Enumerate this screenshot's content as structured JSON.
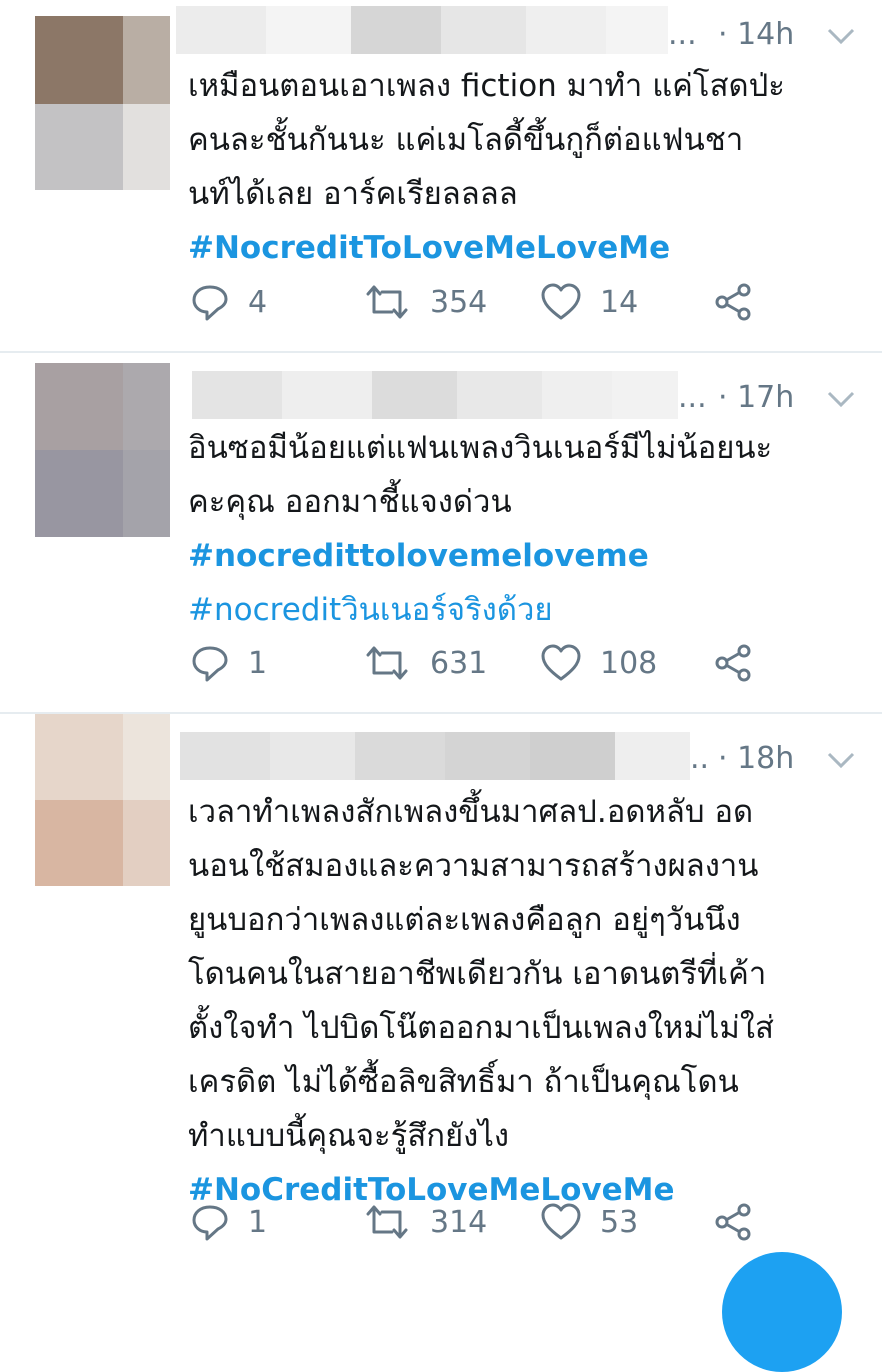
{
  "colors": {
    "link": "#1b95e0",
    "secondary": "#657786",
    "divider": "#e6ecf0",
    "fab": "#1da1f2"
  },
  "tweets": [
    {
      "handle_truncation": "...",
      "time": "· 14h",
      "lines": [
        "เหมือนตอนเอาเพลง fiction มาทำ แค่โสดป่ะ",
        "คนละชั้นกันนะ แค่เมโลดี้ขึ้นกูก็ต่อแฟนชา",
        "นท์ได้เลย อาร์คเรียลลลล"
      ],
      "hashtags": [
        "#NocreditToLoveMeLoveMe"
      ],
      "replies": "4",
      "retweets": "354",
      "likes": "14",
      "icons": [
        "reply-icon",
        "retweet-icon",
        "like-icon",
        "share-icon",
        "chevron-down-icon"
      ]
    },
    {
      "handle_truncation": "...",
      "time": "· 17h",
      "lines": [
        "อินซอมีน้อยแต่แฟนเพลงวินเนอร์มีไม่น้อยนะ",
        "คะคุณ ออกมาชี้แจงด่วน"
      ],
      "hashtags": [
        "#nocredittoloveme loveme",
        "#nocreditวินเนอร์จริงด้วย"
      ],
      "replies": "1",
      "retweets": "631",
      "likes": "108"
    },
    {
      "handle_truncation": "..",
      "time": "· 18h",
      "lines": [
        "เวลาทำเพลงสักเพลงขึ้นมาศลป.อดหลับ อด",
        "นอนใช้สมองและความสามารถสร้างผลงาน",
        "ยูนบอกว่าเพลงแต่ละเพลงคือลูก อยู่ๆวันนึง",
        "โดนคนในสายอาชีพเดียวกัน เอาดนตรีที่เค้า",
        "ตั้งใจทำ ไปบิดโน๊ตออกมาเป็นเพลงใหม่ไม่ใส่",
        "เครดิต ไม่ได้ซื้อลิขสิทธิ์มา ถ้าเป็นคุณโดน",
        "ทำแบบนี้คุณจะรู้สึกยังไง"
      ],
      "hashtags": [
        "#NoCreditToLoveMeLoveMe"
      ],
      "replies": "1",
      "retweets": "314",
      "likes": "53"
    }
  ]
}
